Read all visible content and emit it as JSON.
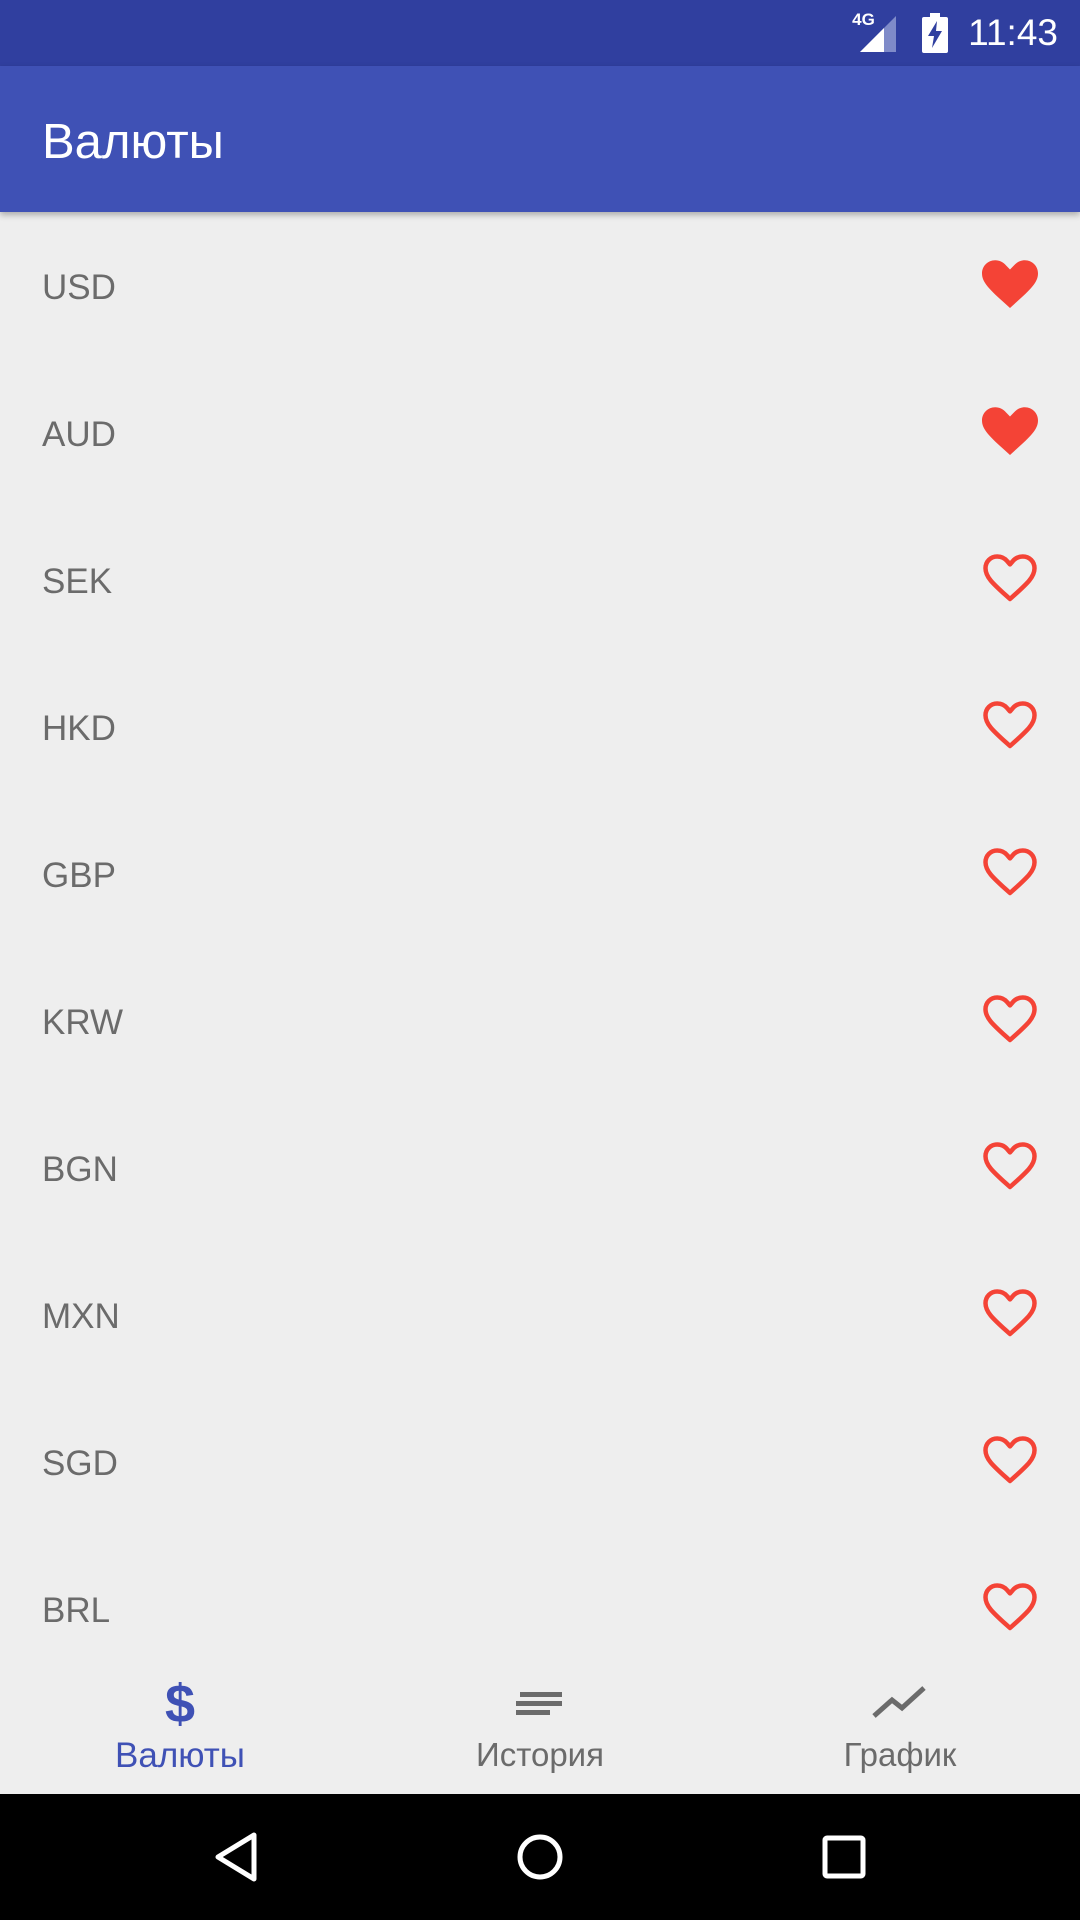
{
  "status_bar": {
    "network": "4G",
    "time": "11:43"
  },
  "app_bar": {
    "title": "Валюты"
  },
  "currencies": [
    {
      "code": "USD",
      "favorite": true
    },
    {
      "code": "AUD",
      "favorite": true
    },
    {
      "code": "SEK",
      "favorite": false
    },
    {
      "code": "HKD",
      "favorite": false
    },
    {
      "code": "GBP",
      "favorite": false
    },
    {
      "code": "KRW",
      "favorite": false
    },
    {
      "code": "BGN",
      "favorite": false
    },
    {
      "code": "MXN",
      "favorite": false
    },
    {
      "code": "SGD",
      "favorite": false
    },
    {
      "code": "BRL",
      "favorite": false
    }
  ],
  "bottom_nav": {
    "items": [
      {
        "label": "Валюты",
        "icon": "dollar-icon",
        "active": true
      },
      {
        "label": "История",
        "icon": "history-lines-icon",
        "active": false
      },
      {
        "label": "График",
        "icon": "trending-chart-icon",
        "active": false
      }
    ]
  },
  "colors": {
    "primary": "#3f51b5",
    "primary_dark": "#303f9f",
    "accent_heart": "#f44336",
    "text_secondary": "#6b6b6b",
    "background": "#eeeeee"
  },
  "system_nav": {
    "icons": [
      "back-icon",
      "home-icon",
      "recents-icon"
    ]
  }
}
